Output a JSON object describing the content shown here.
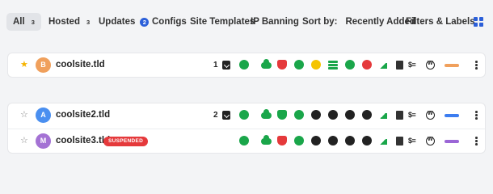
{
  "tabs": [
    {
      "label": "All",
      "count": "3"
    },
    {
      "label": "Hosted",
      "count": "3"
    },
    {
      "label": "Updates",
      "count": "2"
    },
    {
      "label": "Configs"
    },
    {
      "label": "Site Templates"
    },
    {
      "label": "IP Banning"
    }
  ],
  "sort": {
    "label": "Sort by:",
    "value": "Recently Added"
  },
  "filters": {
    "label": "Filters & Labels"
  },
  "colors": {
    "accent": "#2b5fd9",
    "green": "#1aa64a",
    "red": "#e5393b",
    "yellow": "#f5c400",
    "star": "#f5b301"
  },
  "sites": [
    {
      "letter": "B",
      "name": "coolsite.tld",
      "starred": true,
      "avatar_color": "#f0a05c",
      "updates": "1",
      "tag_color": "#f0a05c"
    },
    {
      "letter": "A",
      "name": "coolsite2.tld",
      "starred": false,
      "avatar_color": "#4a8ff0",
      "updates": "2",
      "tag_color": "#3c7df0"
    },
    {
      "letter": "M",
      "name": "coolsite3.tld",
      "starred": false,
      "avatar_color": "#a472d4",
      "status": "SUSPENDED",
      "tag_color": "#9b66d6"
    }
  ],
  "icons": [
    "compass-icon",
    "cloud-icon",
    "shield-icon",
    "bolt-icon",
    "database-icon",
    "plugin-icon",
    "globe-icon",
    "speed-chart-icon",
    "document-icon",
    "money-icon",
    "wordpress-icon",
    "more-vertical-icon"
  ],
  "text": {
    "money": "$≡",
    "star_on": "★",
    "star_off": "☆",
    "chev": "⌄"
  }
}
